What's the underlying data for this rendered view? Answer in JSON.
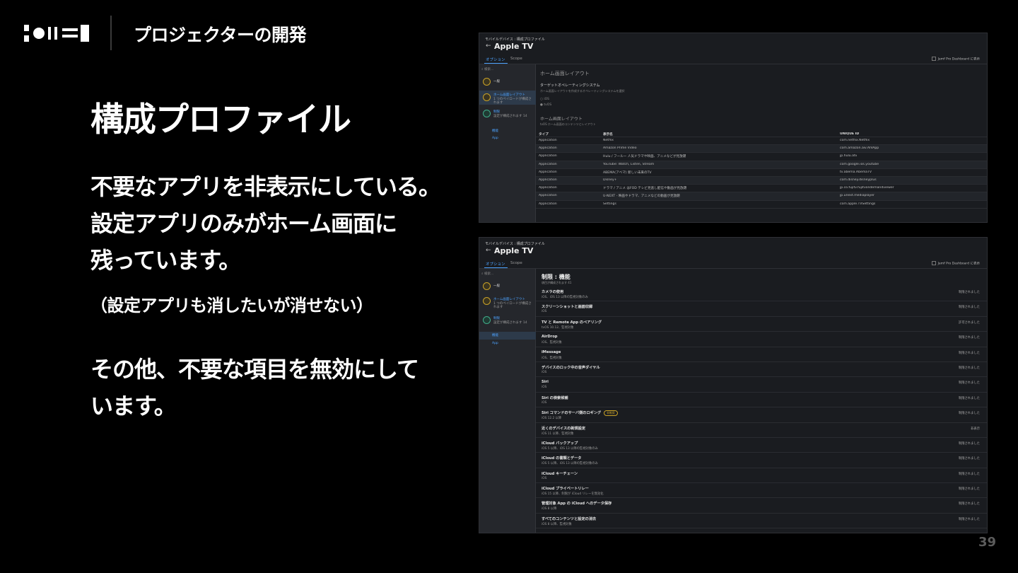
{
  "header": {
    "title": "プロジェクターの開発"
  },
  "slide": {
    "title": "構成プロファイル",
    "paragraph1": [
      "不要なアプリを非表示にしている。",
      "設定アプリのみがホーム画面に",
      "残っています。"
    ],
    "note": "（設定アプリも消したいが消せない）",
    "paragraph2": [
      "その他、不要な項目を無効にして",
      "います。"
    ],
    "page_number": "39"
  },
  "screenshot1": {
    "breadcrumb": "モバイルデバイス : 構成プロファイル",
    "title": "Apple TV",
    "tabs": [
      "オプション",
      "Scope"
    ],
    "jamf_checkbox_label": "Jamf Pro Dashboard に表示",
    "search_placeholder": "検索...",
    "sidebar": [
      {
        "label": "一般",
        "sub": ""
      },
      {
        "label": "ホーム画面レイアウト",
        "sub": "1 つのペイロードが構成されます"
      },
      {
        "label": "制限",
        "sub": "設定が構成されます 14"
      }
    ],
    "sidebar_subs": [
      "機能",
      "App"
    ],
    "section_title": "ホーム画面レイアウト",
    "target_os_label": "ターゲットオペレーティングシステム",
    "target_os_desc": "ホーム画面レイアウトを作成するオペレーティングシステムを選択",
    "os_options": [
      "iOS",
      "tvOS"
    ],
    "layout_title": "ホーム画面レイアウト",
    "layout_desc": "tvOS ホーム画面のコンテンツとレイアウト",
    "columns": [
      "タイプ",
      "表示名",
      "UNIQUE ID"
    ],
    "rows": [
      [
        "Application",
        "Netflix",
        "com.netflix.Netflix"
      ],
      [
        "Application",
        "Amazon Prime Video",
        "com.amazon.aiv.AIVApp"
      ],
      [
        "Application",
        "Hulu / フールー 人気ドラマや映画、アニメなどが見放題",
        "jp.hulu.atv"
      ],
      [
        "Application",
        "YouTube: Watch, Listen, Stream",
        "com.google.ios.youtube"
      ],
      [
        "Application",
        "ABEMA(アベマ) 新しい未来のTV",
        "tv.abema.AbemaTV"
      ],
      [
        "Application",
        "Disney+",
        "com.disney.disneyplus"
      ],
      [
        "Application",
        "ドラマ / アニメ はFOD テレビ見逃し配信や動画が見放題",
        "jp.co.fujitv.fujitvondemandviewer"
      ],
      [
        "Application",
        "U-NEXT - 映画やドラマ、アニメなどの動画が見放題",
        "jp.unext.mediaplayer"
      ],
      [
        "Application",
        "Settings",
        "com.apple.TVSettings"
      ]
    ]
  },
  "screenshot2": {
    "breadcrumb": "モバイルデバイス : 構成プロファイル",
    "title": "Apple TV",
    "tabs": [
      "オプション",
      "Scope"
    ],
    "jamf_checkbox_label": "Jamf Pro Dashboard に表示",
    "search_placeholder": "検索...",
    "sidebar": [
      {
        "label": "一般",
        "sub": ""
      },
      {
        "label": "ホーム画面レイアウト",
        "sub": "1 つのペイロードが構成されます"
      },
      {
        "label": "制限",
        "sub": "設定が構成されます 14"
      }
    ],
    "sidebar_subs": [
      "機能",
      "App"
    ],
    "section_title": "制限 : 機能",
    "section_sub": "項目が構成されます  41",
    "items": [
      {
        "title": "カメラの使用",
        "sub": "iOS、iOS 13 以降の監視対象のみ",
        "value": "制限されました",
        "badge": ""
      },
      {
        "title": "スクリーンショットと画面収録",
        "sub": "iOS",
        "value": "制限されました",
        "badge": ""
      },
      {
        "title": "TV と Remote App のペアリング",
        "sub": "tvOS 10.12、監視対象",
        "value": "許可されました",
        "badge": ""
      },
      {
        "title": "AirDrop",
        "sub": "iOS、監視対象",
        "value": "制限されました",
        "badge": ""
      },
      {
        "title": "iMessage",
        "sub": "iOS、監視対象",
        "value": "制限されました",
        "badge": ""
      },
      {
        "title": "デバイスのロック中の音声ダイヤル",
        "sub": "iOS",
        "value": "制限されました",
        "badge": ""
      },
      {
        "title": "Siri",
        "sub": "iOS",
        "value": "制限されました",
        "badge": ""
      },
      {
        "title": "Siri の検索候補",
        "sub": "iOS",
        "value": "制限されました",
        "badge": ""
      },
      {
        "title": "Siri コマンドのサーバ側のロギング",
        "sub": "iOS 12.2 以降",
        "value": "制限されました",
        "badge": "非推奨"
      },
      {
        "title": "近くのデバイスの新規設定",
        "sub": "iOS 11 以降、監視対象",
        "value": "非表示",
        "badge": ""
      },
      {
        "title": "iCloud バックアップ",
        "sub": "iOS 5 以降、iOS 13 以降の監視対象のみ",
        "value": "制限されました",
        "badge": ""
      },
      {
        "title": "iCloud の書類とデータ",
        "sub": "iOS 5 以降、iOS 13 以降の監視対象のみ",
        "value": "制限されました",
        "badge": ""
      },
      {
        "title": "iCloud キーチェーン",
        "sub": "iOS",
        "value": "制限されました",
        "badge": ""
      },
      {
        "title": "iCloud プライベートリレー",
        "sub": "iOS 15 以降、制限が iCloud リレーを無効化",
        "value": "制限されました",
        "badge": ""
      },
      {
        "title": "管理対象 App の iCloud へのデータ保存",
        "sub": "iOS 8 以降",
        "value": "制限されました",
        "badge": ""
      },
      {
        "title": "すべてのコンテンツと設定の消去",
        "sub": "iOS 8 以降、監視対象",
        "value": "制限されました",
        "badge": ""
      }
    ]
  },
  "colors": {
    "background": "#000000",
    "accent": "#4da3ff",
    "panel": "#1a1c20",
    "warning": "#c9a227"
  }
}
